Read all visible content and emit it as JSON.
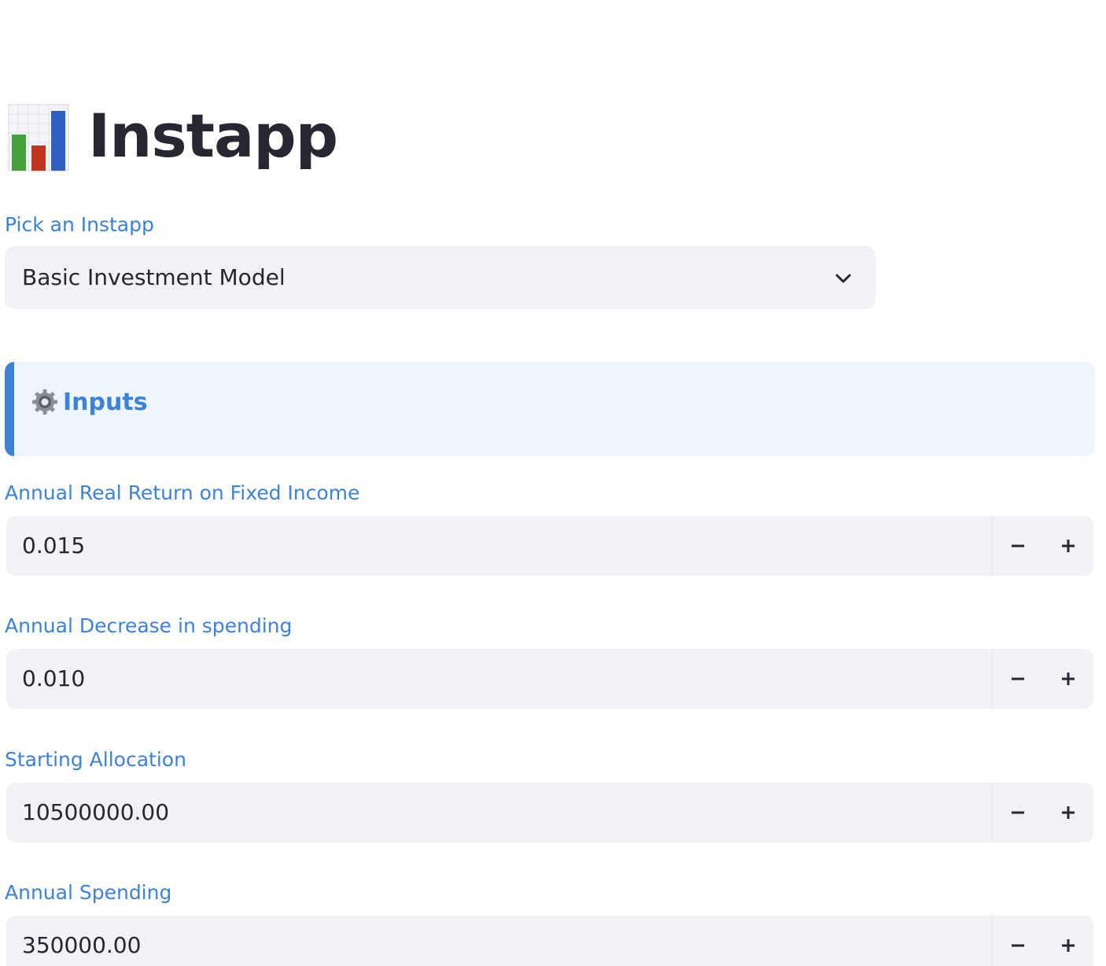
{
  "app": {
    "title": "Instapp",
    "title_icon": "bar-chart-icon"
  },
  "picker": {
    "label": "Pick an Instapp",
    "selected": "Basic Investment Model",
    "icon": "chevron-down-icon"
  },
  "section": {
    "icon": "gear-icon",
    "title": "Inputs",
    "accent_color": "#3d82d8",
    "background_color": "#eef6fd"
  },
  "inputs": [
    {
      "label": "Annual Real Return on Fixed Income",
      "value": "0.015"
    },
    {
      "label": "Annual Decrease in spending",
      "value": "0.010"
    },
    {
      "label": "Starting Allocation",
      "value": "10500000.00"
    },
    {
      "label": "Annual Spending",
      "value": "350000.00"
    }
  ],
  "stepper": {
    "decrement_icon": "minus-icon",
    "increment_icon": "plus-icon"
  },
  "colors": {
    "label": "#3d82d8",
    "text": "#262730",
    "field_bg": "#f0f2f6"
  }
}
